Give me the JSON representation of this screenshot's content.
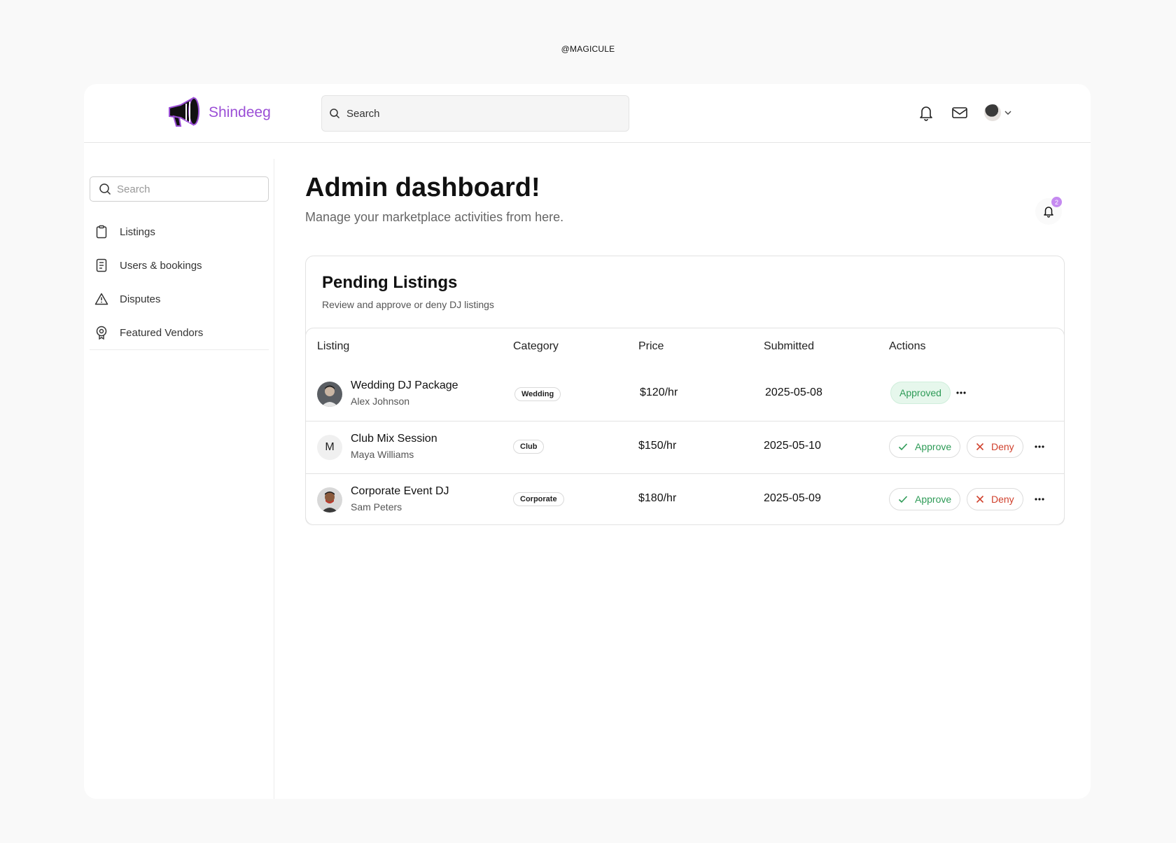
{
  "watermark": "@MAGICULE",
  "brand": {
    "name": "Shindeeg",
    "color": "#9b4fd6"
  },
  "header": {
    "search_placeholder": "Search",
    "icons": [
      "bell-icon",
      "mail-icon",
      "user-avatar",
      "chevron-down-icon"
    ]
  },
  "sidebar": {
    "search_placeholder": "Search",
    "items": [
      {
        "label": "Listings",
        "icon": "clipboard-icon"
      },
      {
        "label": "Users & bookings",
        "icon": "receipt-icon"
      },
      {
        "label": "Disputes",
        "icon": "warning-icon"
      },
      {
        "label": "Featured Vendors",
        "icon": "award-icon"
      }
    ]
  },
  "main": {
    "title": "Admin dashboard!",
    "subtitle": "Manage your marketplace activities from here.",
    "notification_count": "2"
  },
  "pending": {
    "title": "Pending Listings",
    "subtitle": "Review and approve or deny DJ listings",
    "columns": [
      "Listing",
      "Category",
      "Price",
      "Submitted",
      "Actions"
    ],
    "rows": [
      {
        "name": "Wedding DJ Package",
        "owner": "Alex Johnson",
        "avatar": "photo",
        "category": "Wedding",
        "price": "$120/hr",
        "submitted": "2025-05-08",
        "status": "Approved"
      },
      {
        "name": "Club Mix Session",
        "owner": "Maya Williams",
        "avatar": "M",
        "category": "Club",
        "price": "$150/hr",
        "submitted": "2025-05-10",
        "approve_label": "Approve",
        "deny_label": "Deny"
      },
      {
        "name": "Corporate Event DJ",
        "owner": "Sam Peters",
        "avatar": "photo",
        "category": "Corporate",
        "price": "$180/hr",
        "submitted": "2025-05-09",
        "approve_label": "Approve",
        "deny_label": "Deny"
      }
    ]
  },
  "colors": {
    "approve": "#2e9b57",
    "deny": "#d0402c",
    "approved_bg": "#e6f7ec",
    "badge": "#c58af0"
  }
}
